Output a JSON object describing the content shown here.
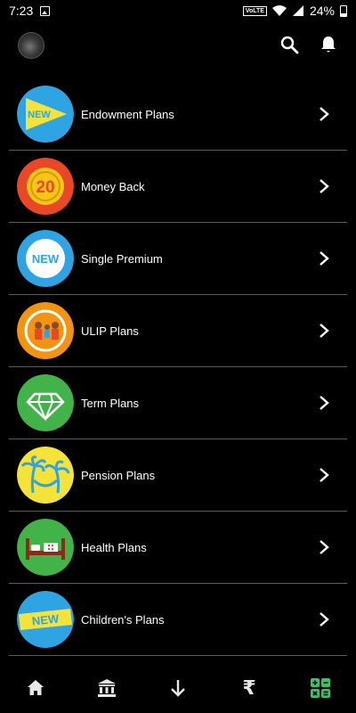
{
  "status_bar": {
    "time": "7:23",
    "network": "VoLTE",
    "battery": "24%"
  },
  "header": {
    "avatar": "profile-avatar",
    "icons": [
      "search-icon",
      "bell-icon"
    ]
  },
  "plans": [
    {
      "label": "Endowment Plans",
      "badge": "NEW",
      "icon": "new-triangle-icon",
      "color": "#2ea4e3"
    },
    {
      "label": "Money Back",
      "badge": "20",
      "icon": "money-back-icon",
      "color": "#e94826"
    },
    {
      "label": "Single Premium",
      "badge": "NEW",
      "icon": "new-badge-icon",
      "color": "#2ea4e3"
    },
    {
      "label": "ULIP Plans",
      "icon": "family-icon",
      "color": "#f29410"
    },
    {
      "label": "Term Plans",
      "icon": "diamond-icon",
      "color": "#41b349"
    },
    {
      "label": "Pension Plans",
      "icon": "palm-hammock-icon",
      "color": "#f5e33a"
    },
    {
      "label": "Health Plans",
      "icon": "hospital-bed-icon",
      "color": "#41b349"
    },
    {
      "label": "Children's Plans",
      "badge": "NEW",
      "icon": "new-ribbon-icon",
      "color": "#2ea4e3"
    }
  ],
  "bottom_nav": {
    "items": [
      "home-icon",
      "bank-icon",
      "download-icon",
      "rupee-icon",
      "calculator-icon"
    ],
    "rupee_symbol": "₹",
    "active_color": "#3dbf6b"
  }
}
